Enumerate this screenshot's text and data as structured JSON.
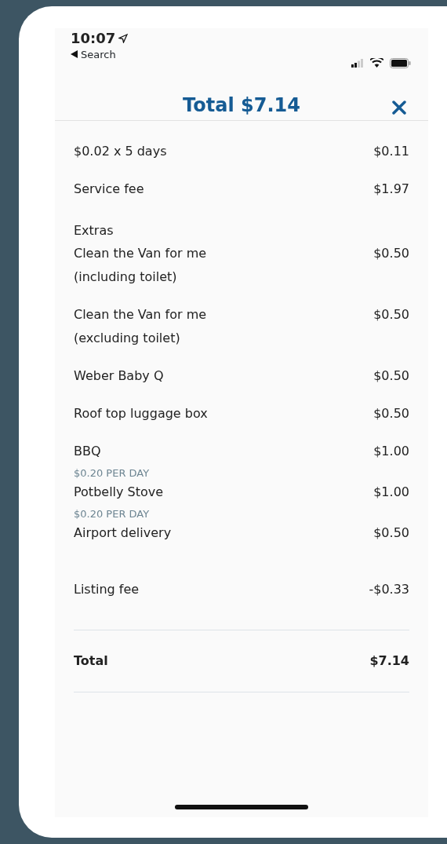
{
  "status_bar": {
    "time": "10:07",
    "back_label": "Search"
  },
  "header": {
    "title": "Total $7.14"
  },
  "charges": [
    {
      "label": "$0.02 x 5 days",
      "amount": "$0.11"
    },
    {
      "label": "Service fee",
      "amount": "$1.97"
    }
  ],
  "extras": {
    "heading": "Extras",
    "items": [
      {
        "label": "Clean the Van for me (including toilet)",
        "amount": "$0.50"
      },
      {
        "label": "Clean the Van for me (excluding toilet)",
        "amount": "$0.50"
      },
      {
        "label": "Weber Baby Q",
        "amount": "$0.50"
      },
      {
        "label": "Roof top luggage box",
        "amount": "$0.50"
      },
      {
        "label": "BBQ",
        "amount": "$1.00",
        "note": "$0.20 PER DAY"
      },
      {
        "label": "Potbelly Stove",
        "amount": "$1.00",
        "note": "$0.20 PER DAY"
      },
      {
        "label": "Airport delivery",
        "amount": "$0.50"
      }
    ]
  },
  "listing_fee": {
    "label": "Listing fee",
    "amount": "-$0.33"
  },
  "total": {
    "label": "Total",
    "amount": "$7.14"
  }
}
